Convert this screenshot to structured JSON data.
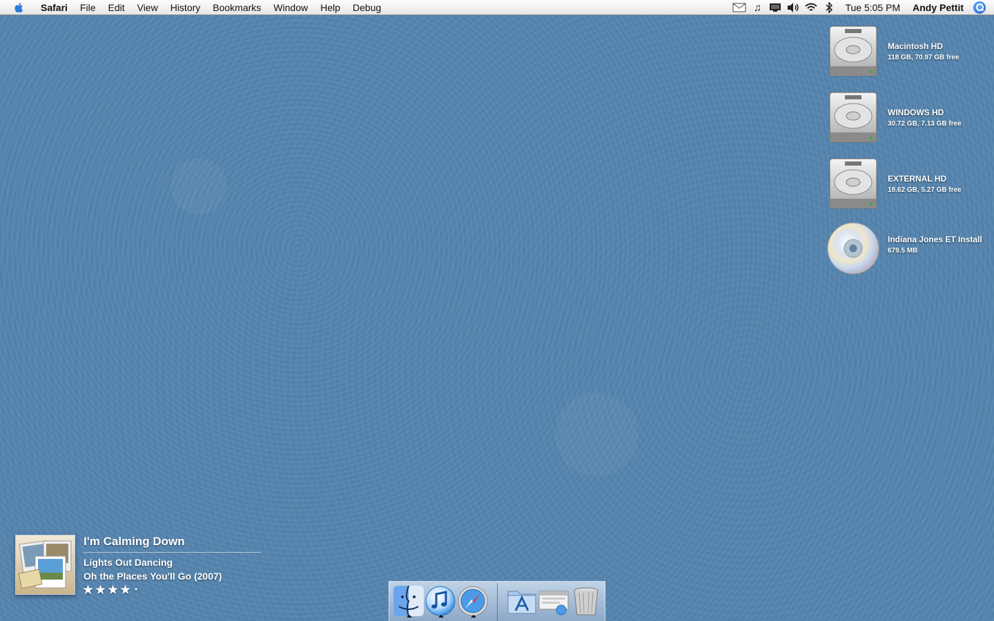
{
  "menubar": {
    "app_name": "Safari",
    "menus": [
      "File",
      "Edit",
      "View",
      "History",
      "Bookmarks",
      "Window",
      "Help",
      "Debug"
    ],
    "status_icons": [
      "mail-icon",
      "music-note-icon",
      "display-icon",
      "volume-icon",
      "wifi-icon",
      "bluetooth-icon"
    ],
    "clock": "Tue 5:05 PM",
    "user": "Andy Pettit"
  },
  "desktop": {
    "volumes": [
      {
        "name": "Macintosh HD",
        "info": "118 GB, 70.97 GB free",
        "icon": "hard-drive-icon"
      },
      {
        "name": "WINDOWS HD",
        "info": "30.72 GB, 7.13 GB free",
        "icon": "hard-drive-icon"
      },
      {
        "name": "EXTERNAL HD",
        "info": "18.62 GB, 5.27 GB free",
        "icon": "hard-drive-icon"
      },
      {
        "name": "Indiana Jones ET Install",
        "info": "679.5 MB",
        "icon": "cd-icon"
      }
    ]
  },
  "now_playing": {
    "title": "I'm Calming Down",
    "artist": "Lights Out Dancing",
    "album": "Oh the Places You'll Go (2007)",
    "rating_stars": "★★★★",
    "rating_dot": "•",
    "rating": 4
  },
  "dock": {
    "apps": [
      "finder-icon",
      "itunes-icon",
      "safari-icon"
    ],
    "others": [
      "applications-folder-icon",
      "downloads-icon",
      "trash-icon"
    ]
  },
  "colors": {
    "desktop": "#5585af",
    "accent": "#1559c9"
  }
}
